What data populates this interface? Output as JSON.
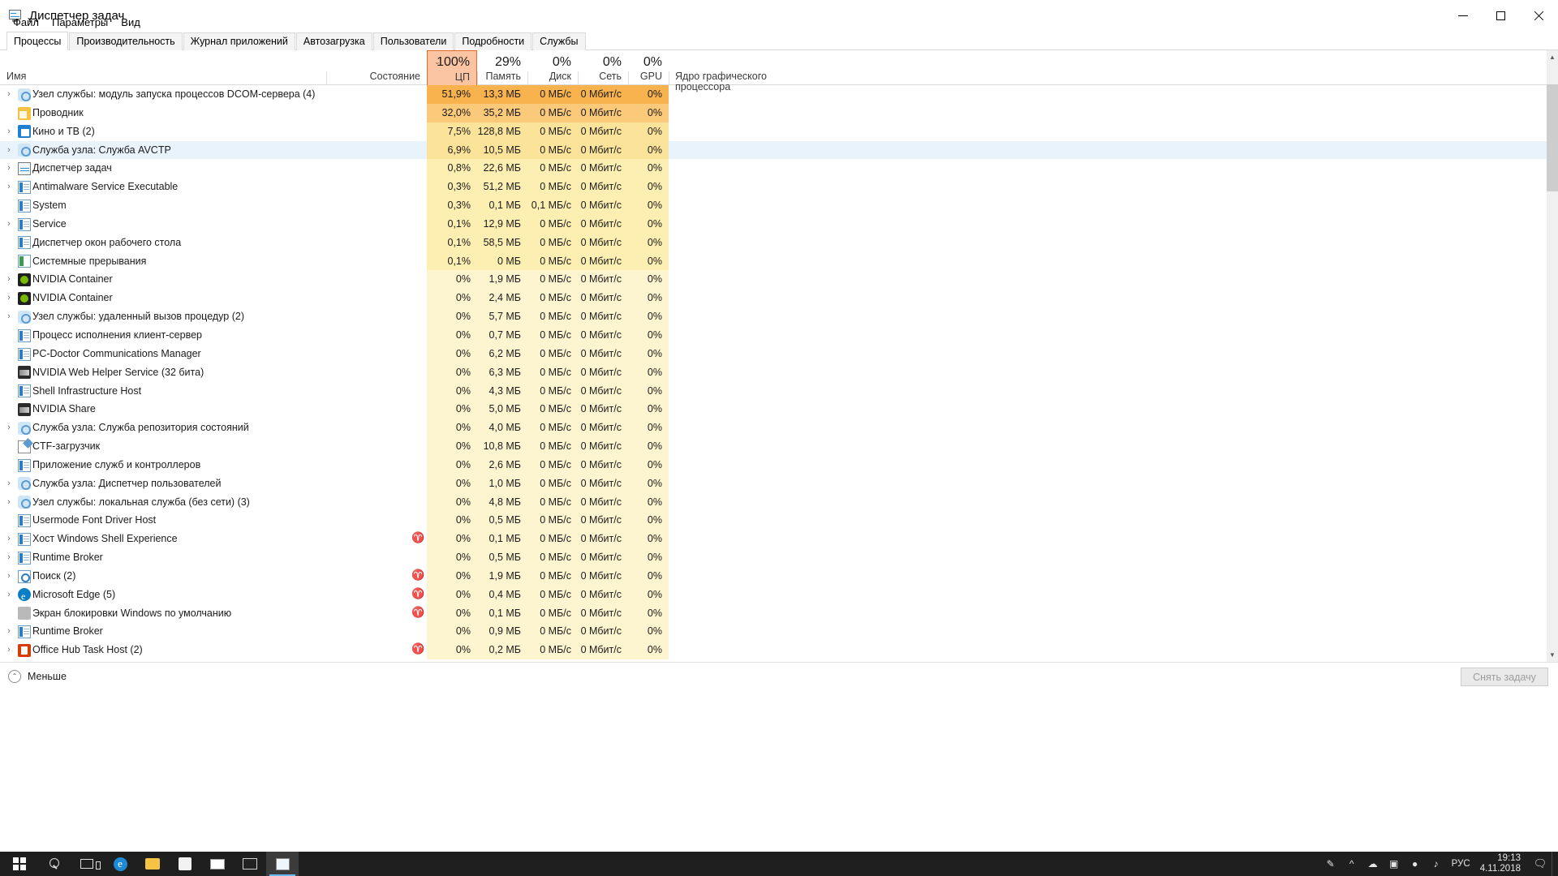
{
  "window": {
    "title": "Диспетчер задач",
    "icon": "task-manager-icon",
    "minimize": "—",
    "maximize": "□",
    "close": "✕"
  },
  "menu": [
    "Файл",
    "Параметры",
    "Вид"
  ],
  "tabs": [
    {
      "label": "Процессы",
      "active": true
    },
    {
      "label": "Производительность",
      "active": false
    },
    {
      "label": "Журнал приложений",
      "active": false
    },
    {
      "label": "Автозагрузка",
      "active": false
    },
    {
      "label": "Пользователи",
      "active": false
    },
    {
      "label": "Подробности",
      "active": false
    },
    {
      "label": "Службы",
      "active": false
    }
  ],
  "columns": [
    {
      "key": "name",
      "label": "Имя",
      "pct": "",
      "sorted": false
    },
    {
      "key": "state",
      "label": "Состояние",
      "pct": "",
      "sorted": false
    },
    {
      "key": "cpu",
      "label": "ЦП",
      "pct": "100%",
      "sorted": true
    },
    {
      "key": "mem",
      "label": "Память",
      "pct": "29%",
      "sorted": false
    },
    {
      "key": "disk",
      "label": "Диск",
      "pct": "0%",
      "sorted": false
    },
    {
      "key": "net",
      "label": "Сеть",
      "pct": "0%",
      "sorted": false
    },
    {
      "key": "gpu",
      "label": "GPU",
      "pct": "0%",
      "sorted": false
    },
    {
      "key": "gpue",
      "label": "Ядро графического процессора",
      "pct": "",
      "sorted": false
    }
  ],
  "sort_caret": "⌄",
  "rows": [
    {
      "expand": true,
      "icon": "service-host-icon",
      "name": "Узел службы: модуль запуска процессов DCOM-сервера (4)",
      "state": "",
      "cpu": "51,9%",
      "mem": "13,3 МБ",
      "disk": "0 МБ/с",
      "net": "0 Мбит/с",
      "gpu": "0%",
      "gpue": "",
      "heat": 4
    },
    {
      "expand": false,
      "icon": "explorer-icon",
      "name": "Проводник",
      "state": "",
      "cpu": "32,0%",
      "mem": "35,2 МБ",
      "disk": "0 МБ/с",
      "net": "0 Мбит/с",
      "gpu": "0%",
      "gpue": "",
      "heat": 3
    },
    {
      "expand": true,
      "icon": "movies-tv-icon",
      "name": "Кино и ТВ (2)",
      "state": "",
      "cpu": "7,5%",
      "mem": "128,8 МБ",
      "disk": "0 МБ/с",
      "net": "0 Мбит/с",
      "gpu": "0%",
      "gpue": "",
      "heat": 2
    },
    {
      "expand": true,
      "icon": "service-host-icon",
      "name": "Служба узла: Служба AVCTP",
      "state": "",
      "cpu": "6,9%",
      "mem": "10,5 МБ",
      "disk": "0 МБ/с",
      "net": "0 Мбит/с",
      "gpu": "0%",
      "gpue": "",
      "heat": 2,
      "selected": true
    },
    {
      "expand": true,
      "icon": "task-manager-icon",
      "name": "Диспетчер задач",
      "state": "",
      "cpu": "0,8%",
      "mem": "22,6 МБ",
      "disk": "0 МБ/с",
      "net": "0 Мбит/с",
      "gpu": "0%",
      "gpue": "",
      "heat": 1
    },
    {
      "expand": true,
      "icon": "windows-exe-icon",
      "name": "Antimalware Service Executable",
      "state": "",
      "cpu": "0,3%",
      "mem": "51,2 МБ",
      "disk": "0 МБ/с",
      "net": "0 Мбит/с",
      "gpu": "0%",
      "gpue": "",
      "heat": 1
    },
    {
      "expand": false,
      "icon": "windows-exe-icon",
      "name": "System",
      "state": "",
      "cpu": "0,3%",
      "mem": "0,1 МБ",
      "disk": "0,1 МБ/с",
      "net": "0 Мбит/с",
      "gpu": "0%",
      "gpue": "",
      "heat": 1
    },
    {
      "expand": true,
      "icon": "windows-exe-icon",
      "name": "Service",
      "state": "",
      "cpu": "0,1%",
      "mem": "12,9 МБ",
      "disk": "0 МБ/с",
      "net": "0 Мбит/с",
      "gpu": "0%",
      "gpue": "",
      "heat": 1
    },
    {
      "expand": false,
      "icon": "windows-exe-icon",
      "name": "Диспетчер окон рабочего стола",
      "state": "",
      "cpu": "0,1%",
      "mem": "58,5 МБ",
      "disk": "0 МБ/с",
      "net": "0 Мбит/с",
      "gpu": "0%",
      "gpue": "",
      "heat": 1
    },
    {
      "expand": false,
      "icon": "system-interrupts-icon",
      "name": "Системные прерывания",
      "state": "",
      "cpu": "0,1%",
      "mem": "0 МБ",
      "disk": "0 МБ/с",
      "net": "0 Мбит/с",
      "gpu": "0%",
      "gpue": "",
      "heat": 1
    },
    {
      "expand": true,
      "icon": "nvidia-icon",
      "name": "NVIDIA Container",
      "state": "",
      "cpu": "0%",
      "mem": "1,9 МБ",
      "disk": "0 МБ/с",
      "net": "0 Мбит/с",
      "gpu": "0%",
      "gpue": "",
      "heat": 0
    },
    {
      "expand": true,
      "icon": "nvidia-icon",
      "name": "NVIDIA Container",
      "state": "",
      "cpu": "0%",
      "mem": "2,4 МБ",
      "disk": "0 МБ/с",
      "net": "0 Мбит/с",
      "gpu": "0%",
      "gpue": "",
      "heat": 0
    },
    {
      "expand": true,
      "icon": "service-host-icon",
      "name": "Узел службы: удаленный вызов процедур (2)",
      "state": "",
      "cpu": "0%",
      "mem": "5,7 МБ",
      "disk": "0 МБ/с",
      "net": "0 Мбит/с",
      "gpu": "0%",
      "gpue": "",
      "heat": 0
    },
    {
      "expand": false,
      "icon": "windows-exe-icon",
      "name": "Процесс исполнения клиент-сервер",
      "state": "",
      "cpu": "0%",
      "mem": "0,7 МБ",
      "disk": "0 МБ/с",
      "net": "0 Мбит/с",
      "gpu": "0%",
      "gpue": "",
      "heat": 0
    },
    {
      "expand": false,
      "icon": "windows-exe-icon",
      "name": "PC-Doctor Communications Manager",
      "state": "",
      "cpu": "0%",
      "mem": "6,2 МБ",
      "disk": "0 МБ/с",
      "net": "0 Мбит/с",
      "gpu": "0%",
      "gpue": "",
      "heat": 0
    },
    {
      "expand": false,
      "icon": "nvidia-share-icon",
      "name": "NVIDIA Web Helper Service (32 бита)",
      "state": "",
      "cpu": "0%",
      "mem": "6,3 МБ",
      "disk": "0 МБ/с",
      "net": "0 Мбит/с",
      "gpu": "0%",
      "gpue": "",
      "heat": 0
    },
    {
      "expand": false,
      "icon": "windows-exe-icon",
      "name": "Shell Infrastructure Host",
      "state": "",
      "cpu": "0%",
      "mem": "4,3 МБ",
      "disk": "0 МБ/с",
      "net": "0 Мбит/с",
      "gpu": "0%",
      "gpue": "",
      "heat": 0
    },
    {
      "expand": false,
      "icon": "nvidia-share-icon",
      "name": "NVIDIA Share",
      "state": "",
      "cpu": "0%",
      "mem": "5,0 МБ",
      "disk": "0 МБ/с",
      "net": "0 Мбит/с",
      "gpu": "0%",
      "gpue": "",
      "heat": 0
    },
    {
      "expand": true,
      "icon": "service-host-icon",
      "name": "Служба узла: Служба репозитория состояний",
      "state": "",
      "cpu": "0%",
      "mem": "4,0 МБ",
      "disk": "0 МБ/с",
      "net": "0 Мбит/с",
      "gpu": "0%",
      "gpue": "",
      "heat": 0
    },
    {
      "expand": false,
      "icon": "ctf-loader-icon",
      "name": "CTF-загрузчик",
      "state": "",
      "cpu": "0%",
      "mem": "10,8 МБ",
      "disk": "0 МБ/с",
      "net": "0 Мбит/с",
      "gpu": "0%",
      "gpue": "",
      "heat": 0
    },
    {
      "expand": false,
      "icon": "windows-exe-icon",
      "name": "Приложение служб и контроллеров",
      "state": "",
      "cpu": "0%",
      "mem": "2,6 МБ",
      "disk": "0 МБ/с",
      "net": "0 Мбит/с",
      "gpu": "0%",
      "gpue": "",
      "heat": 0
    },
    {
      "expand": true,
      "icon": "service-host-icon",
      "name": "Служба узла: Диспетчер пользователей",
      "state": "",
      "cpu": "0%",
      "mem": "1,0 МБ",
      "disk": "0 МБ/с",
      "net": "0 Мбит/с",
      "gpu": "0%",
      "gpue": "",
      "heat": 0
    },
    {
      "expand": true,
      "icon": "service-host-icon",
      "name": "Узел службы: локальная служба (без сети) (3)",
      "state": "",
      "cpu": "0%",
      "mem": "4,8 МБ",
      "disk": "0 МБ/с",
      "net": "0 Мбит/с",
      "gpu": "0%",
      "gpue": "",
      "heat": 0
    },
    {
      "expand": false,
      "icon": "windows-exe-icon",
      "name": "Usermode Font Driver Host",
      "state": "",
      "cpu": "0%",
      "mem": "0,5 МБ",
      "disk": "0 МБ/с",
      "net": "0 Мбит/с",
      "gpu": "0%",
      "gpue": "",
      "heat": 0
    },
    {
      "expand": true,
      "icon": "shell-experience-icon",
      "name": "Хост Windows Shell Experience",
      "state": "suspended",
      "cpu": "0%",
      "mem": "0,1 МБ",
      "disk": "0 МБ/с",
      "net": "0 Мбит/с",
      "gpu": "0%",
      "gpue": "",
      "heat": 0
    },
    {
      "expand": true,
      "icon": "windows-exe-icon",
      "name": "Runtime Broker",
      "state": "",
      "cpu": "0%",
      "mem": "0,5 МБ",
      "disk": "0 МБ/с",
      "net": "0 Мбит/с",
      "gpu": "0%",
      "gpue": "",
      "heat": 0
    },
    {
      "expand": true,
      "icon": "search-icon",
      "name": "Поиск (2)",
      "state": "suspended",
      "cpu": "0%",
      "mem": "1,9 МБ",
      "disk": "0 МБ/с",
      "net": "0 Мбит/с",
      "gpu": "0%",
      "gpue": "",
      "heat": 0
    },
    {
      "expand": true,
      "icon": "edge-icon",
      "name": "Microsoft Edge (5)",
      "state": "suspended",
      "cpu": "0%",
      "mem": "0,4 МБ",
      "disk": "0 МБ/с",
      "net": "0 Мбит/с",
      "gpu": "0%",
      "gpue": "",
      "heat": 0
    },
    {
      "expand": false,
      "icon": "lockscreen-icon",
      "name": "Экран блокировки Windows по умолчанию",
      "state": "suspended",
      "cpu": "0%",
      "mem": "0,1 МБ",
      "disk": "0 МБ/с",
      "net": "0 Мбит/с",
      "gpu": "0%",
      "gpue": "",
      "heat": 0
    },
    {
      "expand": true,
      "icon": "windows-exe-icon",
      "name": "Runtime Broker",
      "state": "",
      "cpu": "0%",
      "mem": "0,9 МБ",
      "disk": "0 МБ/с",
      "net": "0 Мбит/с",
      "gpu": "0%",
      "gpue": "",
      "heat": 0
    },
    {
      "expand": true,
      "icon": "office-hub-icon",
      "name": "Office Hub Task Host (2)",
      "state": "suspended",
      "cpu": "0%",
      "mem": "0,2 МБ",
      "disk": "0 МБ/с",
      "net": "0 Мбит/с",
      "gpu": "0%",
      "gpue": "",
      "heat": 0
    }
  ],
  "expand_glyph": "›",
  "statusbar": {
    "less_label": "Меньше",
    "less_glyph": "⌃",
    "end_task_label": "Снять задачу"
  },
  "scrollbar": {
    "up": "▲",
    "down": "▼"
  },
  "taskbar": {
    "start": "windows-logo-icon",
    "items": [
      {
        "icon": "search-taskbar-icon",
        "name": "taskbar-search",
        "active": false
      },
      {
        "icon": "task-view-icon",
        "name": "taskbar-task-view",
        "active": false
      },
      {
        "icon": "edge-taskbar-icon",
        "name": "taskbar-edge",
        "active": false
      },
      {
        "icon": "explorer-taskbar-icon",
        "name": "taskbar-explorer",
        "active": false
      },
      {
        "icon": "store-taskbar-icon",
        "name": "taskbar-store",
        "active": false
      },
      {
        "icon": "mail-taskbar-icon",
        "name": "taskbar-mail",
        "active": false
      },
      {
        "icon": "movies-taskbar-icon",
        "name": "taskbar-movies",
        "active": false
      },
      {
        "icon": "taskmgr-taskbar-icon",
        "name": "taskbar-task-manager",
        "active": true
      }
    ],
    "tray": [
      "pen-icon",
      "chevron-up-icon",
      "onedrive-icon",
      "display-icon",
      "network-icon",
      "volume-icon"
    ],
    "language": "РУС",
    "time": "19:13",
    "date": "4.11.2018",
    "notifications": "notification-icon"
  },
  "colors": {
    "sort_header_bg": "#fbc5a4",
    "sort_header_border": "#e06c2a",
    "heat_0": "#fdf5cf",
    "heat_1": "#fdeeb2",
    "heat_2": "#fce39a",
    "heat_3": "#fbc97a",
    "heat_4": "#f8b34f",
    "selection": "#e9f3fb",
    "taskbar_bg": "#1f1f1f",
    "accent": "#69b7f0"
  }
}
